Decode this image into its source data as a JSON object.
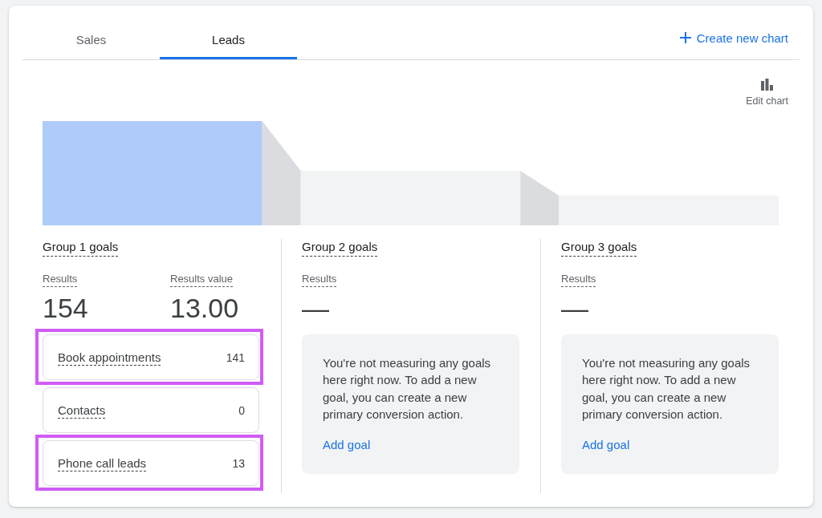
{
  "tabs": [
    {
      "label": "Sales",
      "selected": false
    },
    {
      "label": "Leads",
      "selected": true
    }
  ],
  "create_chart_button": {
    "label": "Create new chart"
  },
  "edit_chart_button": {
    "label": "Edit chart"
  },
  "groups": [
    {
      "title": "Group 1 goals",
      "selected": true,
      "metrics": [
        {
          "label": "Results",
          "value": "154"
        },
        {
          "label": "Results value",
          "value": "13.00"
        }
      ],
      "goals": [
        {
          "name": "Book appointments",
          "value": "141",
          "highlighted": true
        },
        {
          "name": "Contacts",
          "value": "0",
          "highlighted": false
        },
        {
          "name": "Phone call leads",
          "value": "13",
          "highlighted": true
        }
      ]
    },
    {
      "title": "Group 2 goals",
      "selected": false,
      "metrics": [
        {
          "label": "Results",
          "value": "—"
        }
      ],
      "empty_state": {
        "message": "You're not measuring any goals here right now. To add a new goal, you can create a new primary conversion action.",
        "link": "Add goal"
      }
    },
    {
      "title": "Group 3 goals",
      "selected": false,
      "metrics": [
        {
          "label": "Results",
          "value": "—"
        }
      ],
      "empty_state": {
        "message": "You're not measuring any goals here right now. To add a new goal, you can create a new primary conversion action.",
        "link": "Add goal"
      }
    }
  ]
}
